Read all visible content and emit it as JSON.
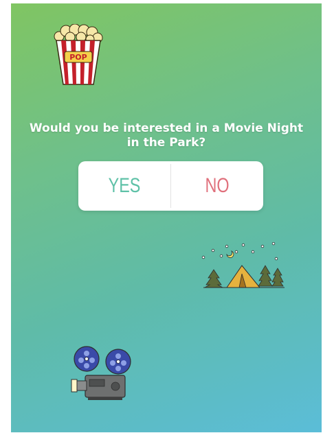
{
  "story": {
    "question": "Would you be interested in a Movie Night in the Park?",
    "poll": {
      "yes_label": "YES",
      "no_label": "NO",
      "yes_color": "#5ec1a7",
      "no_color": "#e0707c"
    },
    "stickers": {
      "popcorn": {
        "icon": "popcorn-icon",
        "text": "POP"
      },
      "campsite": {
        "icon": "campsite-icon"
      },
      "projector": {
        "icon": "film-projector-icon"
      }
    }
  }
}
